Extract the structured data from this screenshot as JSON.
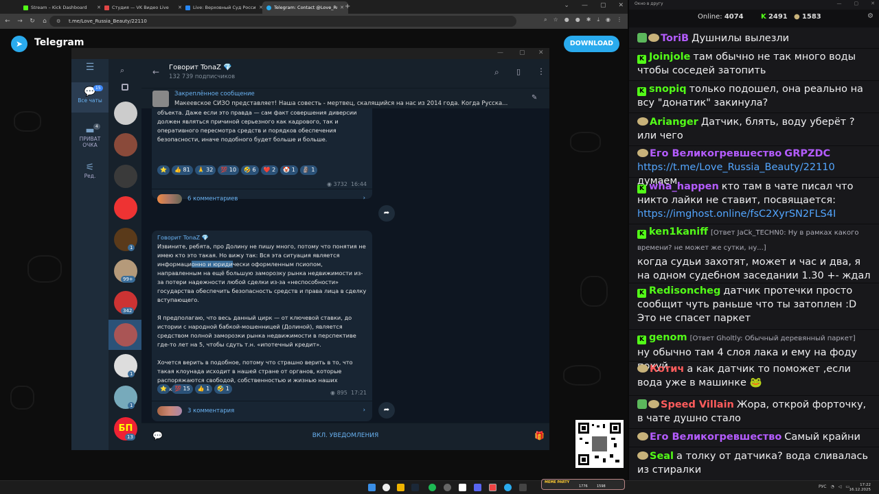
{
  "browser": {
    "tabs": [
      {
        "label": "Stream – Kick Dashboard",
        "color": "#53fc18"
      },
      {
        "label": "Студия — VK Видео Live",
        "color": "#e04646"
      },
      {
        "label": "Live: Верховный Суд Российс...",
        "color": "#2787f5"
      },
      {
        "label": "Telegram: Contact @Love_Russ...",
        "color": "#2aabee"
      }
    ],
    "url": "t.me/Love_Russia_Beauty/22110"
  },
  "telegram": {
    "brand": "Telegram",
    "download_label": "DOWNLOAD",
    "rail": {
      "all_chats": "Все чаты",
      "all_chats_badge": "15",
      "private": "ПРИВАТ ОЧКА",
      "private_badge": "4",
      "edit": "Ред."
    },
    "chat_badges": [
      "1",
      "99+",
      "342",
      "1",
      "1",
      "13"
    ],
    "channel_title": "Говорит TonaZ 💎",
    "channel_subs": "132 739 подписчиков",
    "pinned_title": "Закреплённое сообщение",
    "pinned_text": "Макеевское СИЗО представляет!  Наша совесть - мертвец, скалящийся на нас из 2014 года.  Когда Русска...",
    "msg1": {
      "text": "объекта. Даже если это правда — сам факт совершения диверсии должен являться причиной серьезного как кадрового, так и оперативного пересмотра средств и порядков обеспечения безопасности, иначе подобного будет больше и больше.",
      "reactions": [
        "⭐",
        "👍 81",
        "🙏 32",
        "💯 10",
        "🤣 6",
        "❤️ 2",
        "🤡 1",
        "🗿 1"
      ],
      "views": "3732",
      "time": "16:44",
      "comments": "6 комментариев"
    },
    "msg2": {
      "author": "Говорит TonaZ 💎",
      "p1a": "Извините, ребята, про Долину не пишу много, потому что понятия не имею кто это такая. Но вижу так: Вся эта ситуация является информаци",
      "p1hl": "онно и юриди",
      "p1b": "чески оформленным псиопом, направленным на ещё большую заморозку рынка недвижимости из-за потери надежности любой сделки из-за «неспособности» государства обеспечить безопасность средств и права лица в сделку вступающего.",
      "p2": "Я предполагаю, что весь данный цирк — от ключевой ставки, до истории с народной бабкой-мошенницей (Долиной), является средством полной заморозки рынка недвижимости в перспективе где-то лет на 5, чтобы сдуть т.н. «ипотечный кредит».",
      "p3": "Хочется верить в подобное, потому что страшно верить в то, что такая клоунада исходит в нашей стране от органов, которые распоряжаются свободой, собственностью и жизнью наших граждан.",
      "reactions": [
        "⭐",
        "💯 15",
        "👍 1",
        "🤣 1"
      ],
      "views": "895",
      "time": "17:21",
      "comments": "3 комментария"
    },
    "unmute_label": "ВКЛ. УВЕДОМЛЕНИЯ"
  },
  "chat_panel": {
    "title": "Окно в другу",
    "online_label": "Online:",
    "online": "4074",
    "kick_count": "2491",
    "other_count": "1583",
    "messages": [
      {
        "user": "ToriB",
        "color": "#b45cff",
        "badges": "g,f",
        "text": "Душнилы вылезли"
      },
      {
        "user": "Joinjole",
        "color": "#53fc18",
        "badges": "k",
        "text": "там обычно не так много воды чтобы соседей затопить"
      },
      {
        "user": "snopiq",
        "color": "#53fc18",
        "badges": "k",
        "text": "только подошел, она реально на всу \"донатик\" закинула?"
      },
      {
        "user": "Arianger",
        "color": "#53fc18",
        "badges": "f",
        "text": "Датчик, блять, воду уберёт ? или чего"
      },
      {
        "user": "Его Великогревшество",
        "user2": "GRPZDC",
        "color": "#b45cff",
        "badges": "f",
        "link": "https://t.me/Love_Russia_Beauty/22110",
        "text": "думаем"
      },
      {
        "user": "wha_happen",
        "color": "#b45cff",
        "badges": "k",
        "text": "кто там в чате писал что никто лайки не ставит, посвящается:",
        "link": "https://imghost.online/fsC2XyrSN2FLS4I"
      },
      {
        "user": "ken1kaniff",
        "color": "#53fc18",
        "badges": "k",
        "reply": "[Ответ JaCk_TECHN0: Ну в рамках какого времени? не может же сутки, ну...]",
        "text": "когда судьи захотят, может и час и два, я на одном судебном заседании 1.30 +- ждал"
      },
      {
        "user": "Redisoncheg",
        "color": "#53fc18",
        "badges": "k",
        "text": "датчик протечки просто сообщит чуть раньше что ты затоплен :D Это не спасет паркет"
      },
      {
        "user": "genom",
        "color": "#53fc18",
        "badges": "k",
        "reply": "[Ответ Gholtly: Обычный деревянный паркет]",
        "text": "ну обычно там 4 слоя лака и ему на фоду похуй"
      },
      {
        "user": "Котич",
        "color": "#ff5c5c",
        "badges": "f",
        "text": "а как датчик то поможет ,если вода уже в машинке 🐸"
      },
      {
        "user": "Speed Villain",
        "color": "#ff5c5c",
        "badges": "g,f",
        "text": "Жора, открой форточку, в чате душно стало"
      },
      {
        "user": "Его Великогревшество",
        "color": "#b45cff",
        "badges": "f",
        "text": "Самый крайни"
      },
      {
        "user": "Seal",
        "color": "#53fc18",
        "badges": "f",
        "text": "а толку от датчика? вода сливалась из стиралки"
      }
    ]
  },
  "taskbar": {
    "lang": "РУС",
    "time": "17:22",
    "date": "16.12.2025",
    "meme_label": "MEME PARTY",
    "meme_a": "1776",
    "meme_b": "1598"
  }
}
